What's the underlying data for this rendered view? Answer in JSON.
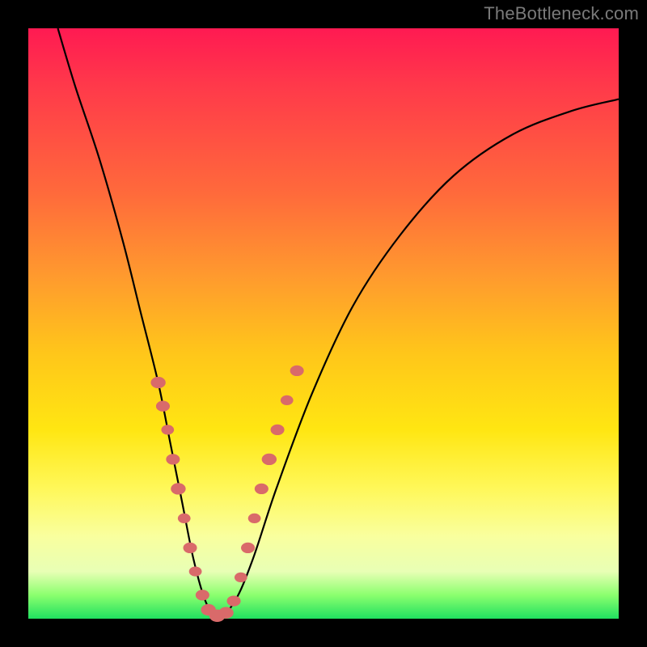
{
  "watermark": "TheBottleneck.com",
  "chart_data": {
    "type": "line",
    "title": "",
    "subtitle": "",
    "xlabel": "",
    "ylabel": "",
    "xlim": [
      0,
      100
    ],
    "ylim": [
      0,
      100
    ],
    "grid": false,
    "series": [
      {
        "name": "bottleneck-curve",
        "x": [
          5,
          8,
          12,
          16,
          19,
          22,
          24,
          26,
          28,
          30,
          32,
          35,
          38,
          42,
          48,
          55,
          63,
          72,
          82,
          92,
          100
        ],
        "y": [
          100,
          90,
          78,
          64,
          52,
          40,
          30,
          20,
          10,
          3,
          0,
          3,
          10,
          22,
          38,
          53,
          65,
          75,
          82,
          86,
          88
        ]
      }
    ],
    "markers": [
      {
        "x": 22.0,
        "y": 40,
        "r": 1.4
      },
      {
        "x": 22.8,
        "y": 36,
        "r": 1.3
      },
      {
        "x": 23.6,
        "y": 32,
        "r": 1.2
      },
      {
        "x": 24.5,
        "y": 27,
        "r": 1.3
      },
      {
        "x": 25.4,
        "y": 22,
        "r": 1.4
      },
      {
        "x": 26.4,
        "y": 17,
        "r": 1.2
      },
      {
        "x": 27.4,
        "y": 12,
        "r": 1.3
      },
      {
        "x": 28.3,
        "y": 8,
        "r": 1.2
      },
      {
        "x": 29.5,
        "y": 4,
        "r": 1.3
      },
      {
        "x": 30.5,
        "y": 1.5,
        "r": 1.4
      },
      {
        "x": 32.0,
        "y": 0.5,
        "r": 1.5
      },
      {
        "x": 33.5,
        "y": 1.0,
        "r": 1.4
      },
      {
        "x": 34.8,
        "y": 3.0,
        "r": 1.3
      },
      {
        "x": 36.0,
        "y": 7,
        "r": 1.2
      },
      {
        "x": 37.2,
        "y": 12,
        "r": 1.3
      },
      {
        "x": 38.3,
        "y": 17,
        "r": 1.2
      },
      {
        "x": 39.5,
        "y": 22,
        "r": 1.3
      },
      {
        "x": 40.8,
        "y": 27,
        "r": 1.4
      },
      {
        "x": 42.2,
        "y": 32,
        "r": 1.3
      },
      {
        "x": 43.8,
        "y": 37,
        "r": 1.2
      },
      {
        "x": 45.5,
        "y": 42,
        "r": 1.3
      }
    ],
    "colors": {
      "curve": "#000000",
      "markers": "#d96a6a",
      "gradient_top": "#ff1a52",
      "gradient_bottom": "#20e060"
    }
  }
}
